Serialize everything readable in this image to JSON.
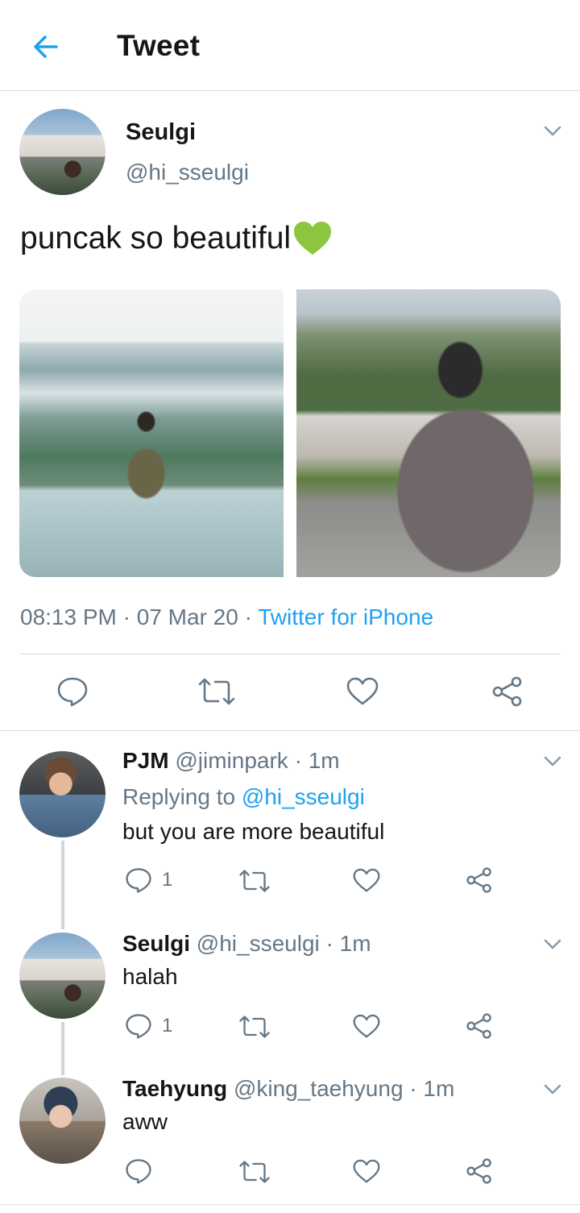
{
  "header": {
    "title": "Tweet",
    "back_icon": "arrow-left-icon",
    "accent_color": "#1da1f2"
  },
  "tweet": {
    "author_name": "Seulgi",
    "author_handle": "@hi_sseulgi",
    "text": "puncak so beautiful",
    "emoji": "green-heart-emoji",
    "time": "08:13 PM",
    "date": "07 Mar 20",
    "source": "Twitter for iPhone",
    "photos": [
      "photo-1",
      "photo-2"
    ]
  },
  "replies": [
    {
      "name": "PJM",
      "handle": "@jiminpark",
      "time": "1m",
      "replying_prefix": "Replying to",
      "replying_to": "@hi_sseulgi",
      "text": "but you are more beautiful",
      "reply_count": "1"
    },
    {
      "name": "Seulgi",
      "handle": "@hi_sseulgi",
      "time": "1m",
      "text": "halah",
      "reply_count": "1"
    },
    {
      "name": "Taehyung",
      "handle": "@king_taehyung",
      "time": "1m",
      "text": "aww",
      "reply_count": ""
    }
  ],
  "colors": {
    "text_primary": "#14171a",
    "text_secondary": "#657786",
    "link": "#1da1f2",
    "divider": "#d7dde2",
    "thread_line": "#ccd6dd",
    "icon": "#657786"
  }
}
